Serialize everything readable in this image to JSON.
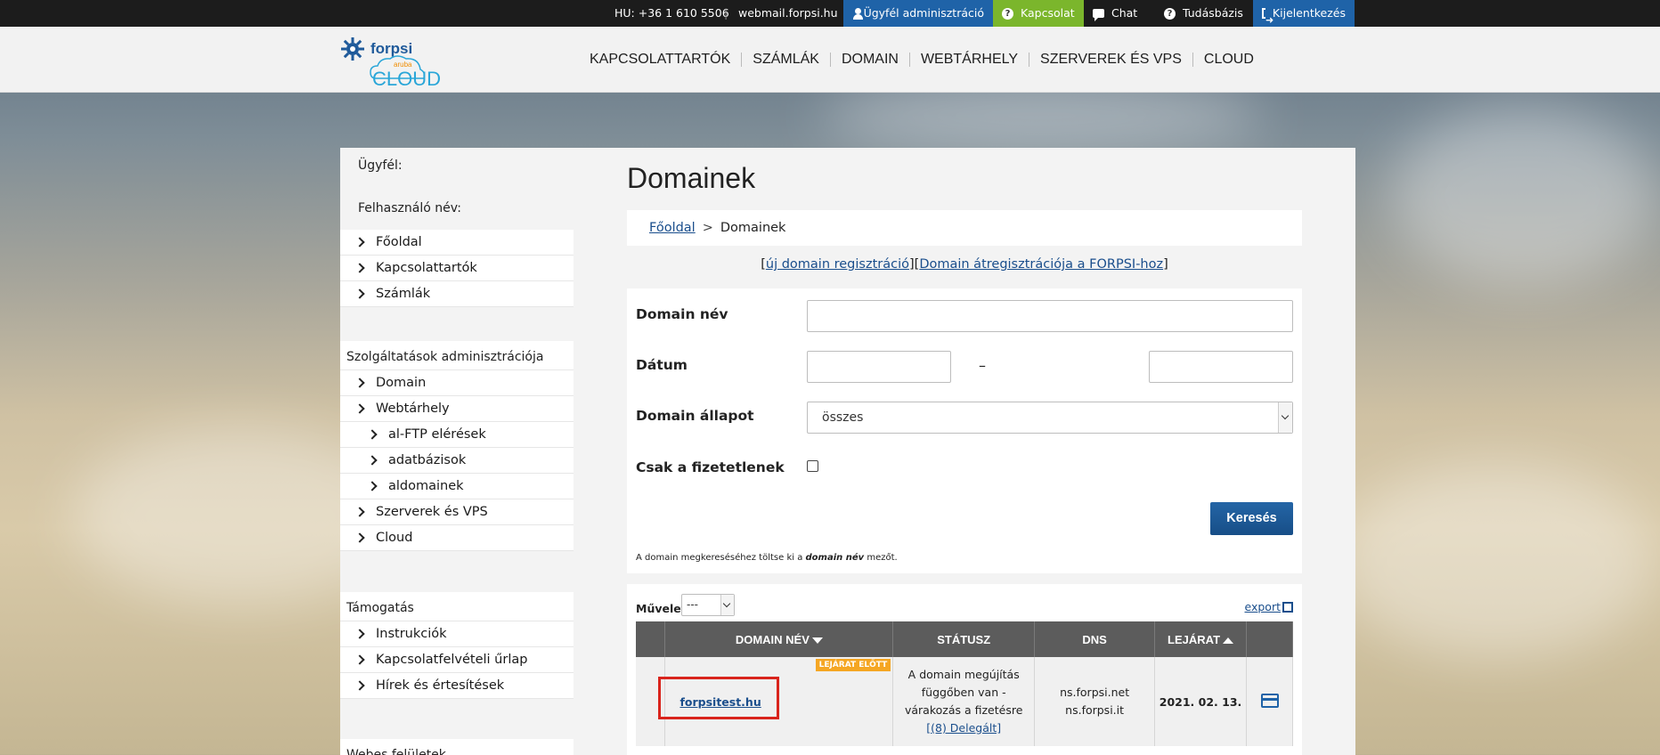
{
  "topbar": {
    "phone": "HU: +36 1 610 5506",
    "separator": "|",
    "webmail": "webmail.forpsi.hu",
    "buttons": [
      {
        "label": "Ügyfél adminisztráció",
        "icon": "user-icon",
        "color": "#1f63a8"
      },
      {
        "label": "Kapcsolat",
        "icon": "question-icon",
        "color": "#7bb62c"
      },
      {
        "label": "Chat",
        "icon": "chat-icon"
      },
      {
        "label": "Tudásbázis",
        "icon": "question-icon"
      },
      {
        "label": "Kijelentkezés",
        "icon": "logout-icon",
        "color": "#1f63a8"
      }
    ]
  },
  "logo": {
    "brand": "forpsi",
    "sub": "aruba",
    "product": "CLOUD"
  },
  "mainnav": [
    "KAPCSOLATTARTÓK",
    "SZÁMLÁK",
    "DOMAIN",
    "WEBTÁRHELY",
    "SZERVEREK ÉS VPS",
    "CLOUD"
  ],
  "sidebar": {
    "customer_label": "Ügyfél:",
    "username_label": "Felhasználó név:",
    "block1": [
      "Főoldal",
      "Kapcsolattartók",
      "Számlák"
    ],
    "services_title": "Szolgáltatások adminisztrációja",
    "services": [
      {
        "label": "Domain",
        "sub": false
      },
      {
        "label": "Webtárhely",
        "sub": false
      },
      {
        "label": "al-FTP elérések",
        "sub": true
      },
      {
        "label": "adatbázisok",
        "sub": true
      },
      {
        "label": "aldomainek",
        "sub": true
      },
      {
        "label": "Szerverek és VPS",
        "sub": false
      },
      {
        "label": "Cloud",
        "sub": false
      }
    ],
    "support_title": "Támogatás",
    "support": [
      "Instrukciók",
      "Kapcsolatfelvételi űrlap",
      "Hírek és értesítések"
    ],
    "next_title": "Webes felületek"
  },
  "main": {
    "title": "Domainek",
    "breadcrumb": {
      "home": "Főoldal",
      "sep": ">",
      "current": "Domainek"
    },
    "reg_links": {
      "left_bracket": "[",
      "new_reg": "új domain regisztráció",
      "mid": "][",
      "transfer": "Domain átregisztrációja a FORPSI-hoz",
      "right_bracket": "]"
    },
    "filter": {
      "domain_label": "Domain név",
      "domain_value": "",
      "date_label": "Dátum",
      "date_dash": "–",
      "date_from": "",
      "date_to": "",
      "state_label": "Domain állapot",
      "state_value": "összes",
      "unpaid_label": "Csak a fizetetlenek",
      "unpaid_checked": false,
      "search_button": "Keresés",
      "hint_pre": "A domain megkereséséhez töltse ki a ",
      "hint_bold": "domain név",
      "hint_post": " mezőt."
    },
    "results": {
      "op_label": "Művelet",
      "op_value": "---",
      "export_label": "export",
      "columns": [
        "",
        "DOMAIN NÉV",
        "STÁTUSZ",
        "DNS",
        "LEJÁRAT",
        ""
      ],
      "rows": [
        {
          "badge": "LEJÁRAT ELŐTT",
          "domain": "forpsitest.hu",
          "status_lines": [
            "A domain megújítás",
            "függőben van -",
            "várakozás a fizetésre"
          ],
          "status_link": "[(8) Delegált]",
          "dns": [
            "ns.forpsi.net",
            "ns.forpsi.it"
          ],
          "expiry": "2021. 02. 13.",
          "action_icon": "credit-card-icon"
        }
      ]
    }
  }
}
